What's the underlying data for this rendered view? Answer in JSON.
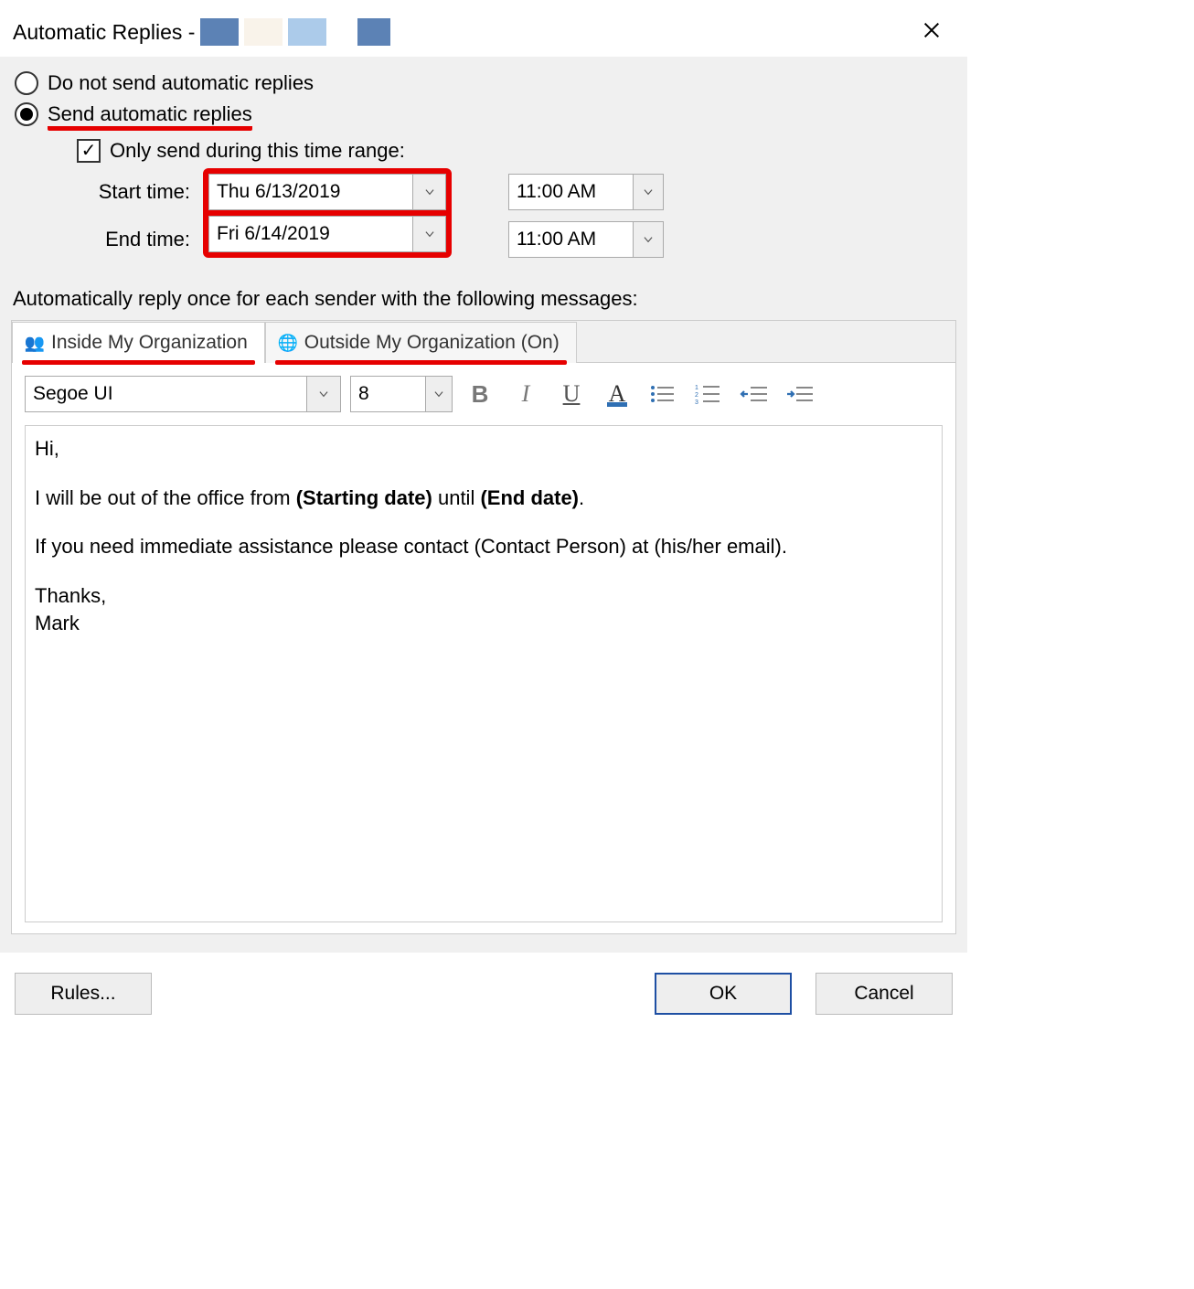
{
  "titlebar": {
    "title": "Automatic Replies - "
  },
  "options": {
    "do_not_send_label": "Do not send automatic replies",
    "send_label": "Send automatic replies",
    "only_send_range_label": "Only send during this time range:",
    "start_label": "Start time:",
    "end_label": "End time:",
    "start_date": "Thu 6/13/2019",
    "start_time": "11:00 AM",
    "end_date": "Fri 6/14/2019",
    "end_time": "11:00 AM"
  },
  "instruction": "Automatically reply once for each sender with the following messages:",
  "tabs": {
    "inside_label": "Inside My Organization",
    "outside_label": "Outside My Organization (On)"
  },
  "toolbar": {
    "font_name": "Segoe UI",
    "font_size": "8"
  },
  "message": {
    "l1": "Hi,",
    "l2a": "I will be out of the office from ",
    "l2b": "(Starting date)",
    "l2c": " until ",
    "l2d": "(End date)",
    "l2e": ".",
    "l3": "If you need immediate assistance please contact (Contact Person) at (his/her email).",
    "l4": "Thanks,",
    "l5": "Mark"
  },
  "footer": {
    "rules": "Rules...",
    "ok": "OK",
    "cancel": "Cancel"
  }
}
